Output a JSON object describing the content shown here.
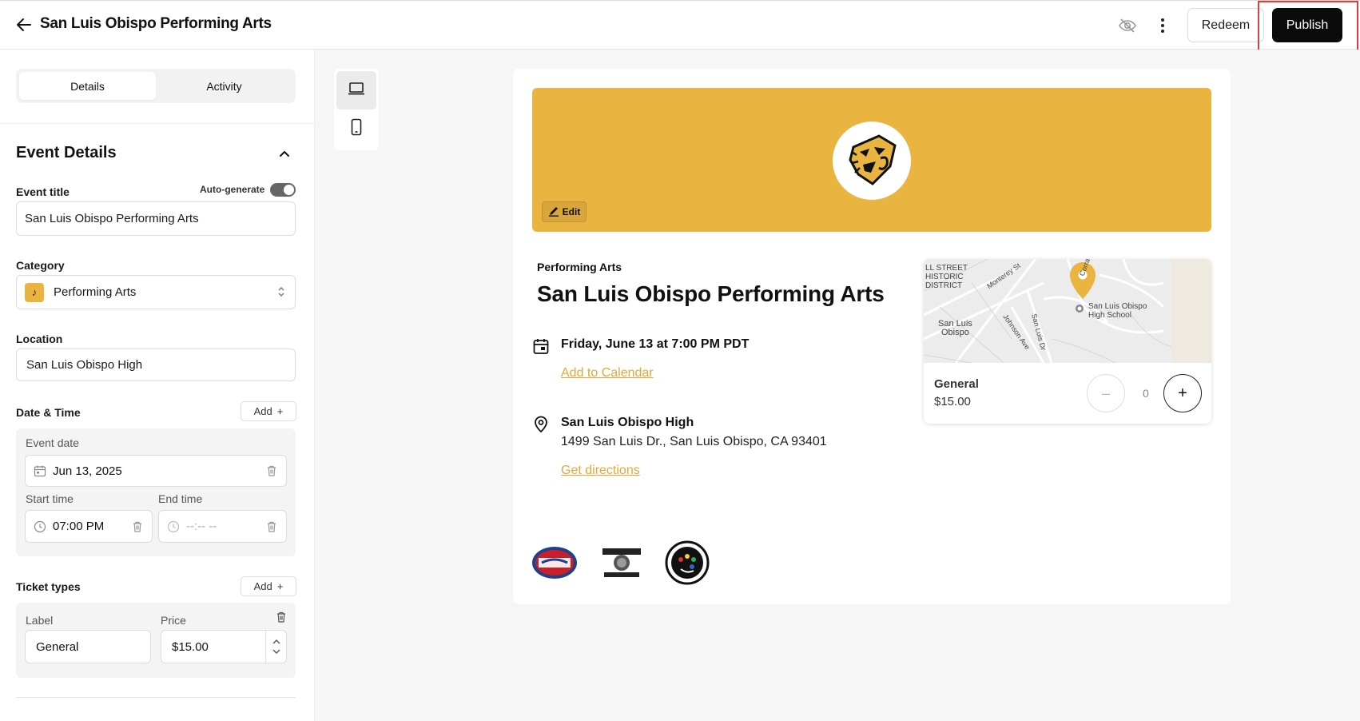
{
  "header": {
    "title": "San Luis Obispo Performing Arts",
    "redeem_label": "Redeem",
    "publish_label": "Publish"
  },
  "sidebar": {
    "tabs": [
      {
        "label": "Details",
        "active": true
      },
      {
        "label": "Activity",
        "active": false
      }
    ],
    "section_title": "Event Details",
    "event_title": {
      "label": "Event title",
      "auto_generate_label": "Auto-generate",
      "value": "San Luis Obispo Performing Arts"
    },
    "category": {
      "label": "Category",
      "value": "Performing Arts"
    },
    "location": {
      "label": "Location",
      "value": "San Luis Obispo High"
    },
    "date_time": {
      "label": "Date & Time",
      "add_label": "Add",
      "event_date_label": "Event date",
      "event_date": "Jun 13, 2025",
      "start_time_label": "Start time",
      "start_time": "07:00 PM",
      "end_time_label": "End time",
      "end_time_placeholder": "--:-- --"
    },
    "ticket_types": {
      "label": "Ticket types",
      "add_label": "Add",
      "col_label": "Label",
      "col_price": "Price",
      "ticket_label": "General",
      "ticket_price": "$15.00"
    }
  },
  "preview": {
    "edit_label": "Edit",
    "category": "Performing Arts",
    "title": "San Luis Obispo Performing Arts",
    "date_text": "Friday, June 13 at 7:00 PM PDT",
    "add_calendar": "Add to Calendar",
    "location_name": "San Luis Obispo High",
    "address": "1499 San Luis Dr., San Luis Obispo, CA 93401",
    "directions": "Get directions",
    "map_labels": {
      "district": "LL STREET\nHISTORIC\nDISTRICT",
      "city": "San Luis\nObispo",
      "school": "San Luis Obispo\nHigh School",
      "street1": "Monterey St",
      "street2": "Johnson Ave",
      "street3": "San Luis Dr",
      "street4": "Corral"
    },
    "ticket": {
      "name": "General",
      "price": "$15.00",
      "quantity": "0",
      "minus": "–",
      "plus": "+"
    },
    "sponsors": [
      "Jersey Mike's Subs",
      "Woodstock Pizza",
      "Art Central"
    ]
  },
  "colors": {
    "accent": "#e9b440",
    "link": "#e0a93a",
    "primary_button": "#0b0b0b",
    "highlight": "#d9403a"
  }
}
